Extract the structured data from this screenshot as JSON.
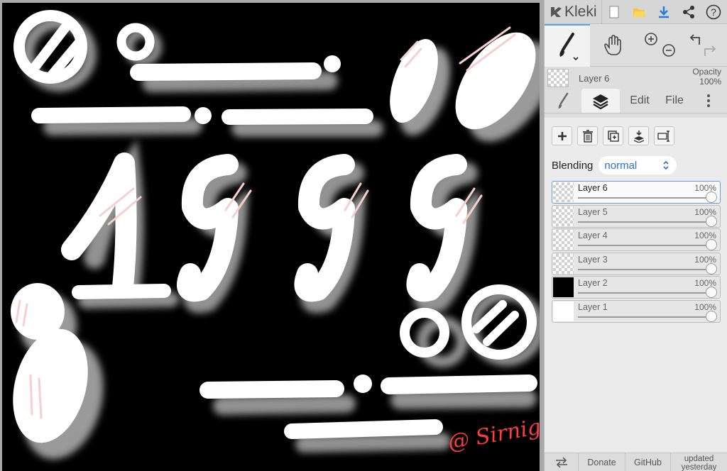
{
  "app": {
    "name": "Kleki"
  },
  "topbar": {
    "icons": [
      "new-image-icon",
      "open-folder-icon",
      "download-icon",
      "share-icon",
      "help-icon"
    ]
  },
  "tools": [
    "brush-tool",
    "hand-tool",
    "zoom-in",
    "zoom-out",
    "undo",
    "redo"
  ],
  "current_layer": {
    "name": "Layer 6",
    "opacity_label": "Opacity",
    "opacity_value": "100%"
  },
  "tabs": {
    "edit": "Edit",
    "file": "File"
  },
  "layers_panel": {
    "blending_label": "Blending",
    "blending_value": "normal",
    "layers": [
      {
        "name": "Layer 6",
        "opacity": "100%",
        "opacity_fraction": 1.0,
        "thumb": "transparent",
        "selected": true
      },
      {
        "name": "Layer 5",
        "opacity": "100%",
        "opacity_fraction": 1.0,
        "thumb": "transparent",
        "selected": false
      },
      {
        "name": "Layer 4",
        "opacity": "100%",
        "opacity_fraction": 1.0,
        "thumb": "transparent",
        "selected": false
      },
      {
        "name": "Layer 3",
        "opacity": "100%",
        "opacity_fraction": 1.0,
        "thumb": "transparent",
        "selected": false
      },
      {
        "name": "Layer 2",
        "opacity": "100%",
        "opacity_fraction": 1.0,
        "thumb": "black",
        "selected": false
      },
      {
        "name": "Layer 1",
        "opacity": "100%",
        "opacity_fraction": 1.0,
        "thumb": "white",
        "selected": false
      }
    ]
  },
  "bottombar": {
    "donate": "Donate",
    "github": "GitHub",
    "updated": "updated yesterday"
  },
  "artwork": {
    "numerals": [
      "1",
      "9",
      "9",
      "9"
    ],
    "signature_text": "@ Sirnight"
  },
  "colors": {
    "accent": "#2a6fd6",
    "canvas_bg": "#000000",
    "stroke": "#ffffff",
    "shadow": "#9a9a9a",
    "highlight": "#f6cfcf",
    "signature": "#ff3b3b"
  }
}
